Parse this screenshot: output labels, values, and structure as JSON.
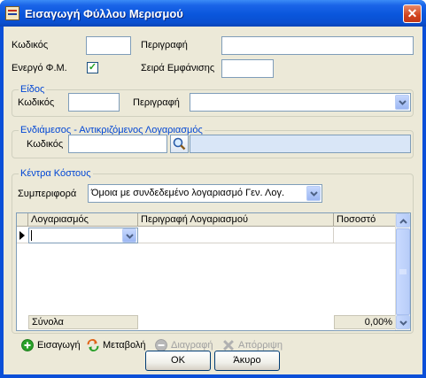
{
  "window": {
    "title": "Εισαγωγή Φύλλου Μερισμού",
    "close_glyph": "✕"
  },
  "form": {
    "code_label": "Κωδικός",
    "code_value": "",
    "description_label": "Περιγραφή",
    "description_value": "",
    "active_label": "Ενεργό Φ.Μ.",
    "active_checked": true,
    "display_order_label": "Σειρά Εμφάνισης",
    "display_order_value": ""
  },
  "type_group": {
    "title": "Είδος",
    "code_label": "Κωδικός",
    "code_value": "",
    "description_label": "Περιγραφή",
    "description_value": ""
  },
  "intermediate_group": {
    "title": "Ενδιάμεσος - Αντικριζόμενος Λογαριασμός",
    "code_label": "Κωδικός",
    "code_value": "",
    "description_value": ""
  },
  "cost_centers_group": {
    "title": "Κέντρα Κόστους",
    "behavior_label": "Συμπεριφορά",
    "behavior_value": "Όμοια με συνδεδεμένο λογαριασμό Γεν. Λογ."
  },
  "grid": {
    "columns": [
      "Λογαριασμός",
      "Περιγραφή Λογαριασμού",
      "Ποσοστό"
    ],
    "row_account": "",
    "row_description": "",
    "row_percent": "",
    "totals_label": "Σύνολα",
    "totals_value": "0,00%"
  },
  "toolbar": {
    "insert": "Εισαγωγή",
    "modify": "Μεταβολή",
    "delete": "Διαγραφή",
    "reject": "Απόρριψη"
  },
  "buttons": {
    "ok": "OK",
    "cancel": "Άκυρο"
  },
  "colors": {
    "titlebar": "#0a56dc",
    "group_title": "#0046d5",
    "window_bg": "#ece9d8",
    "check_mark": "#21a121",
    "insert_icon": "#2aa12a",
    "disabled_text": "#a0a0a0"
  },
  "icons": {
    "app": "sheet-icon",
    "search": "magnifier-icon",
    "insert": "plus-circle-icon",
    "modify": "refresh-icon",
    "delete": "minus-circle-icon",
    "reject": "x-icon"
  }
}
